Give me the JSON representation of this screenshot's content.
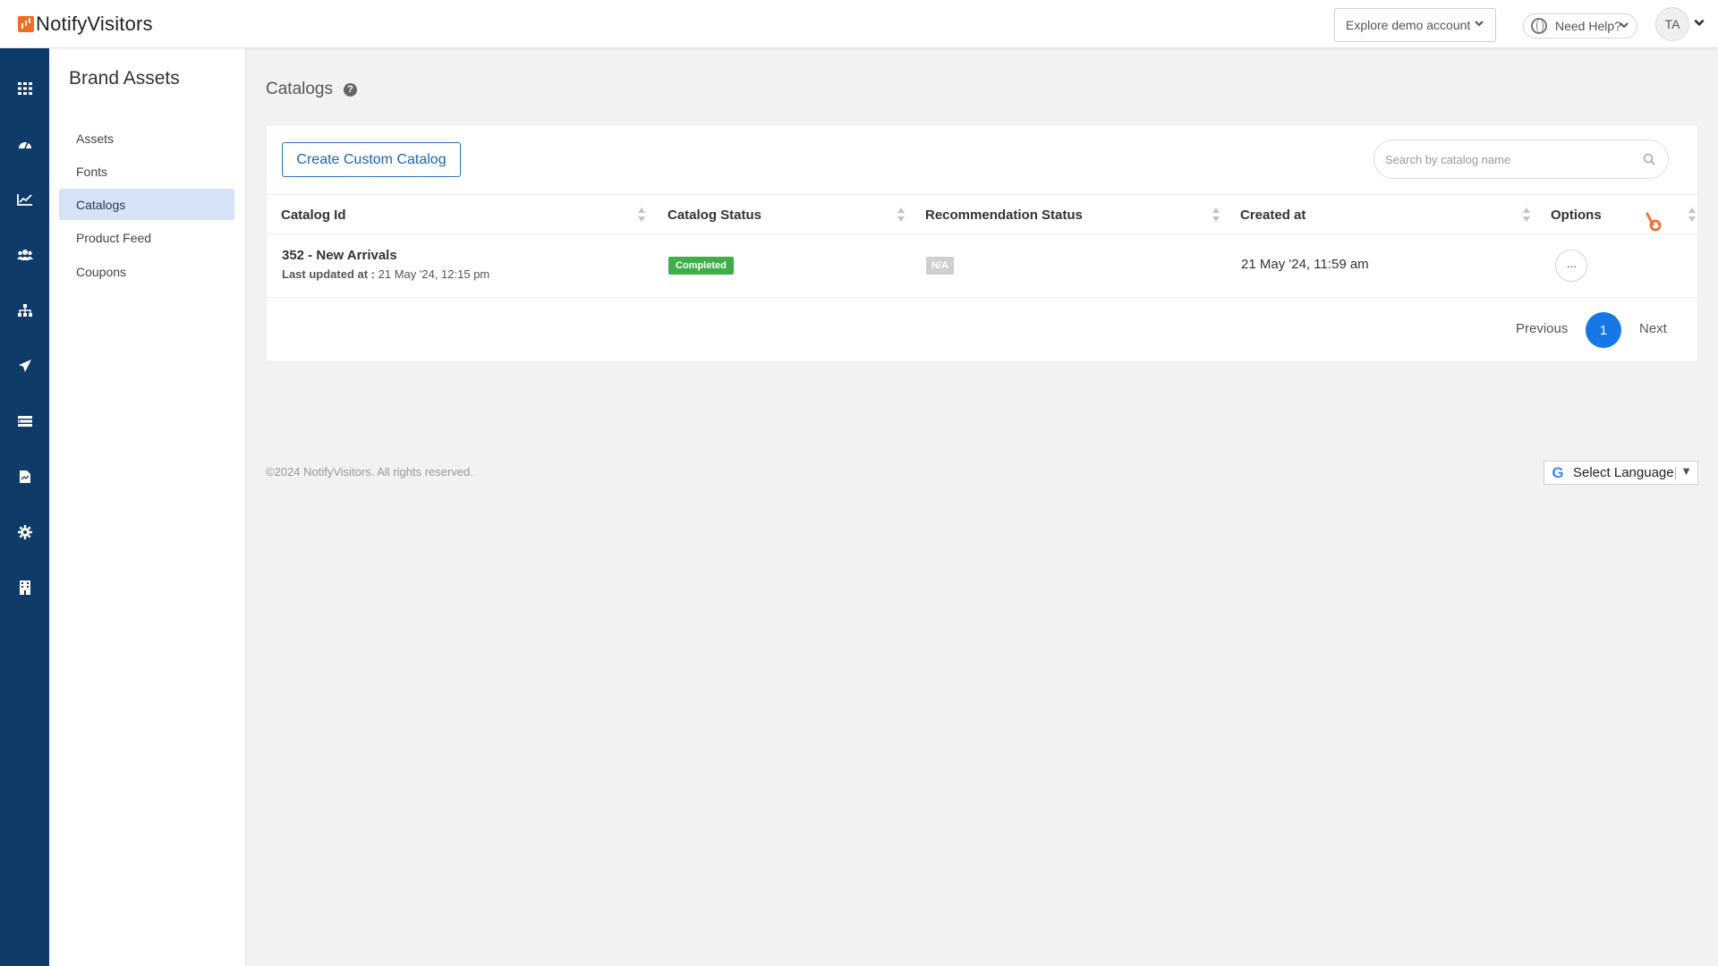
{
  "header": {
    "logo_text": "NotifyVisitors",
    "demo_account_label": "Explore demo account",
    "help_label": "Need Help?",
    "avatar_initials": "TA"
  },
  "rail": {
    "icons": [
      "grid-icon",
      "dashboard-gauge-icon",
      "analytics-chart-icon",
      "users-icon",
      "sitemap-icon",
      "send-plane-icon",
      "list-icon",
      "document-icon",
      "settings-gear-icon",
      "building-icon"
    ],
    "color": "#0f3b68"
  },
  "sidebar": {
    "title": "Brand Assets",
    "items": [
      {
        "label": "Assets",
        "active": false
      },
      {
        "label": "Fonts",
        "active": false
      },
      {
        "label": "Catalogs",
        "active": true
      },
      {
        "label": "Product Feed",
        "active": false
      },
      {
        "label": "Coupons",
        "active": false
      }
    ]
  },
  "main": {
    "page_title": "Catalogs",
    "create_button": "Create Custom Catalog",
    "search_placeholder": "Search by catalog name",
    "columns": [
      "Catalog Id",
      "Catalog Status",
      "Recommendation Status",
      "Created at",
      "Options"
    ],
    "rows": [
      {
        "catalog": "352 - New Arrivals",
        "updated_label": "Last updated at :",
        "updated_value": "21 May '24, 12:15 pm",
        "catalog_status": "Completed",
        "recommendation_status": "N/A",
        "created_at": "21 May '24, 11:59 am",
        "options": "···"
      }
    ],
    "pagination": {
      "previous": "Previous",
      "current": "1",
      "next": "Next"
    }
  },
  "footer": {
    "copyright": "©2024 NotifyVisitors. All rights reserved.",
    "language_label": "Select Language"
  },
  "colors": {
    "accent": "#1677e6",
    "status_completed": "#3fae49",
    "status_na": "#cfcfcf",
    "sidebar_active": "#d6e2f5",
    "brand_orange": "#f26b22"
  }
}
